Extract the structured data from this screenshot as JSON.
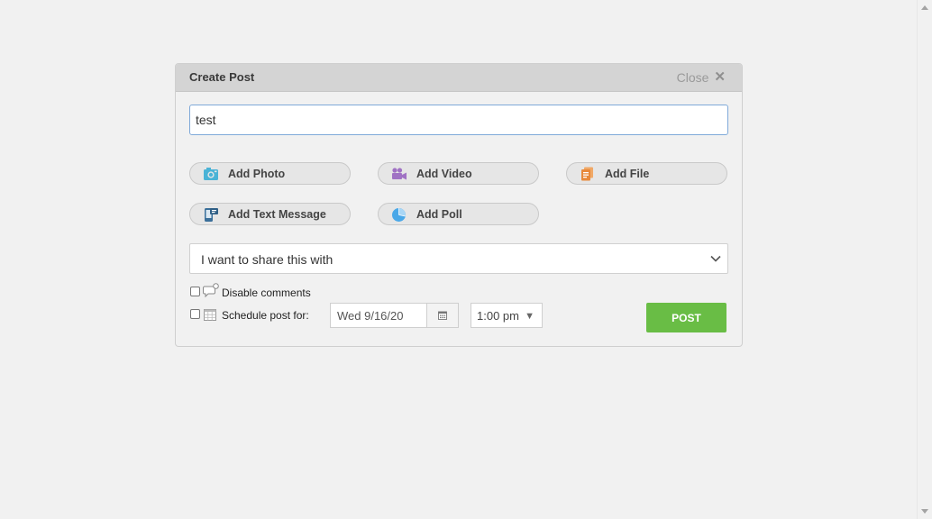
{
  "dialog": {
    "title": "Create Post",
    "close_label": "Close"
  },
  "post": {
    "text_value": "test"
  },
  "attachments": [
    {
      "label": "Add Photo",
      "icon": "camera-icon",
      "color": "#4ab3d6"
    },
    {
      "label": "Add Video",
      "icon": "video-camera-icon",
      "color": "#a072c4"
    },
    {
      "label": "Add File",
      "icon": "file-icon",
      "color": "#e8893a"
    },
    {
      "label": "Add Text Message",
      "icon": "phone-message-icon",
      "color": "#3a6f9a"
    },
    {
      "label": "Add Poll",
      "icon": "pie-chart-icon",
      "color": "#4aa8e8"
    }
  ],
  "share": {
    "selected": "I want to share this with"
  },
  "options": {
    "disable_comments_label": "Disable comments",
    "schedule_label": "Schedule post for:",
    "date_value": "Wed  9/16/20",
    "time_value": "1:00 pm"
  },
  "actions": {
    "post_label": "POST",
    "post_color": "#69bd45"
  }
}
